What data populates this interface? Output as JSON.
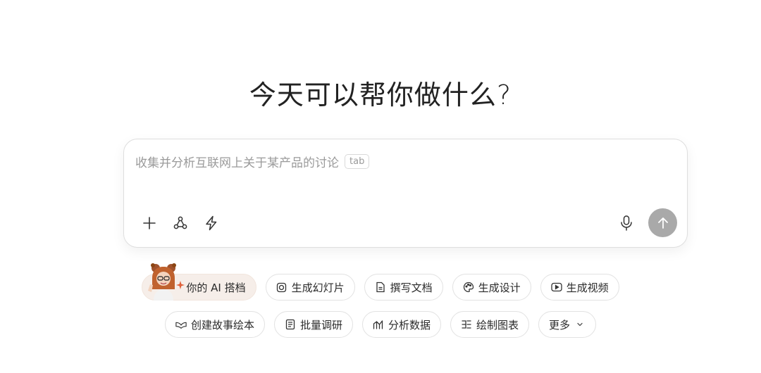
{
  "headline": "今天可以帮你做什么?",
  "composer": {
    "placeholder": "收集并分析互联网上关于某产品的讨论",
    "tab_hint": "tab"
  },
  "chips_row1": [
    {
      "label": "你的 AI 搭档",
      "icon": "ai-partner-avatar"
    },
    {
      "label": "生成幻灯片",
      "icon": "slides-icon"
    },
    {
      "label": "撰写文档",
      "icon": "document-icon"
    },
    {
      "label": "生成设计",
      "icon": "palette-icon"
    },
    {
      "label": "生成视频",
      "icon": "video-icon"
    }
  ],
  "chips_row2": [
    {
      "label": "创建故事绘本",
      "icon": "storybook-icon"
    },
    {
      "label": "批量调研",
      "icon": "research-icon"
    },
    {
      "label": "分析数据",
      "icon": "chart-icon"
    },
    {
      "label": "绘制图表",
      "icon": "diagram-icon"
    },
    {
      "label": "更多",
      "icon": "chevron-down-icon"
    }
  ],
  "colors": {
    "send_button": "#a9a9a9",
    "ai_chip_bg": "#f6eee9",
    "placeholder": "#9a9a9a"
  }
}
